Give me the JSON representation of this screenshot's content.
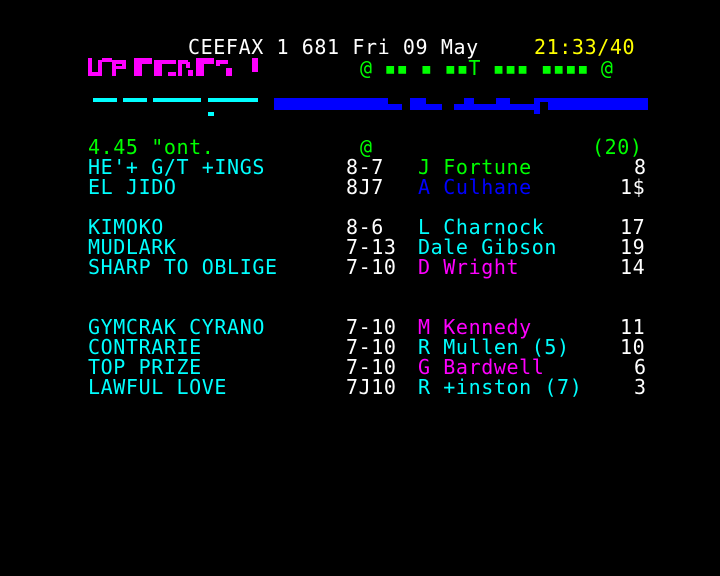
{
  "header": {
    "service": "CEEFAX 1 681 Fri 09 May",
    "clock": "21:33/40"
  },
  "masthead": {
    "logo_text": "SPORT",
    "line2_text": "@ ▪▪ ▪ ▪▪T ▪▪▪ ▪▪▪▪ @",
    "colors": {
      "logo": "#ff00ff",
      "line2": "#00ff00",
      "band_left": "#00ffff",
      "band_right": "#0000ff"
    }
  },
  "race": {
    "time_course": "4.45 \"ont.",
    "marker": "@",
    "runners_count": "(20)"
  },
  "runners": [
    {
      "name": "HE'+ G/T +INGS",
      "weight": "8-7",
      "jockey": "J Fortune",
      "jockey_color": "#00ff00",
      "draw": "8"
    },
    {
      "name": "EL JIDO",
      "weight": "8J7",
      "jockey": "A Culhane",
      "jockey_color": "#0000ff",
      "draw": "1$"
    },
    {
      "name": "KIMOKO",
      "weight": "8-6",
      "jockey": "L Charnock",
      "jockey_color": "#00ffff",
      "draw": "17"
    },
    {
      "name": "MUDLARK",
      "weight": "7-13",
      "jockey": "Dale Gibson",
      "jockey_color": "#00ffff",
      "draw": "19"
    },
    {
      "name": "SHARP TO OBLIGE",
      "weight": "7-10",
      "jockey": "D Wright",
      "jockey_color": "#ff00ff",
      "draw": "14"
    },
    {
      "name": "GYMCRAK CYRANO",
      "weight": "7-10",
      "jockey": "M Kennedy",
      "jockey_color": "#ff00ff",
      "draw": "11"
    },
    {
      "name": "CONTRARIE",
      "weight": "7-10",
      "jockey": "R Mullen (5)",
      "jockey_color": "#00ffff",
      "draw": "10"
    },
    {
      "name": "TOP PRIZE",
      "weight": "7-10",
      "jockey": "G Bardwell",
      "jockey_color": "#ff00ff",
      "draw": "6"
    },
    {
      "name": "LAWFUL LOVE",
      "weight": "7J10",
      "jockey": "R +inston (7)",
      "jockey_color": "#00ffff",
      "draw": "3"
    }
  ]
}
